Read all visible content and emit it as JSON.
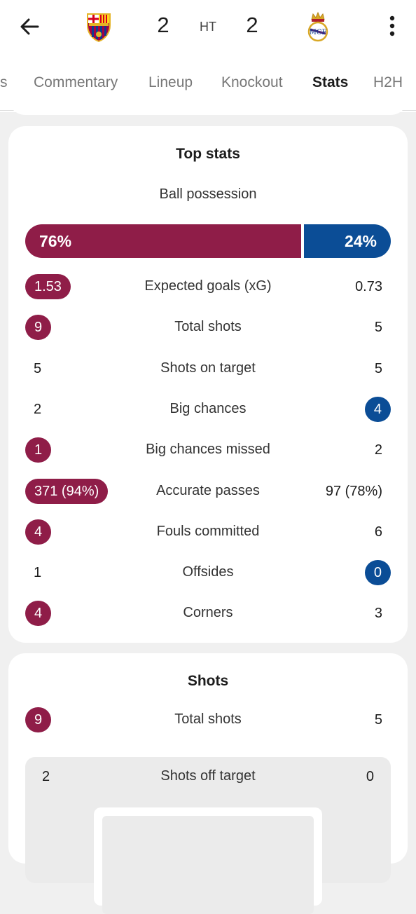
{
  "header": {
    "home_score": "2",
    "away_score": "2",
    "status": "HT",
    "colors": {
      "home": "#8f1d48",
      "away": "#0b4d96"
    }
  },
  "icons": {
    "back": "arrow-left-icon",
    "menu": "more-vertical-icon",
    "home_crest": "barcelona-crest",
    "away_crest": "real-madrid-crest"
  },
  "tabs": [
    {
      "label": "s"
    },
    {
      "label": "Commentary"
    },
    {
      "label": "Lineup"
    },
    {
      "label": "Knockout"
    },
    {
      "label": "Stats",
      "active": true
    },
    {
      "label": "H2H"
    }
  ],
  "top_stats": {
    "title": "Top stats",
    "possession": {
      "label": "Ball possession",
      "home": "76%",
      "away": "24%",
      "home_fraction": 0.76
    },
    "rows": [
      {
        "label": "Expected goals (xG)",
        "home": "1.53",
        "away": "0.73",
        "highlight": "home"
      },
      {
        "label": "Total shots",
        "home": "9",
        "away": "5",
        "highlight": "home"
      },
      {
        "label": "Shots on target",
        "home": "5",
        "away": "5",
        "highlight": "none"
      },
      {
        "label": "Big chances",
        "home": "2",
        "away": "4",
        "highlight": "away"
      },
      {
        "label": "Big chances missed",
        "home": "1",
        "away": "2",
        "highlight": "home"
      },
      {
        "label": "Accurate passes",
        "home": "371 (94%)",
        "away": "97 (78%)",
        "highlight": "home"
      },
      {
        "label": "Fouls committed",
        "home": "4",
        "away": "6",
        "highlight": "home"
      },
      {
        "label": "Offsides",
        "home": "1",
        "away": "0",
        "highlight": "away"
      },
      {
        "label": "Corners",
        "home": "4",
        "away": "3",
        "highlight": "home"
      }
    ]
  },
  "shots": {
    "title": "Shots",
    "total": {
      "label": "Total shots",
      "home": "9",
      "away": "5",
      "highlight": "home"
    },
    "off_target": {
      "label": "Shots off target",
      "home": "2",
      "away": "0"
    }
  }
}
